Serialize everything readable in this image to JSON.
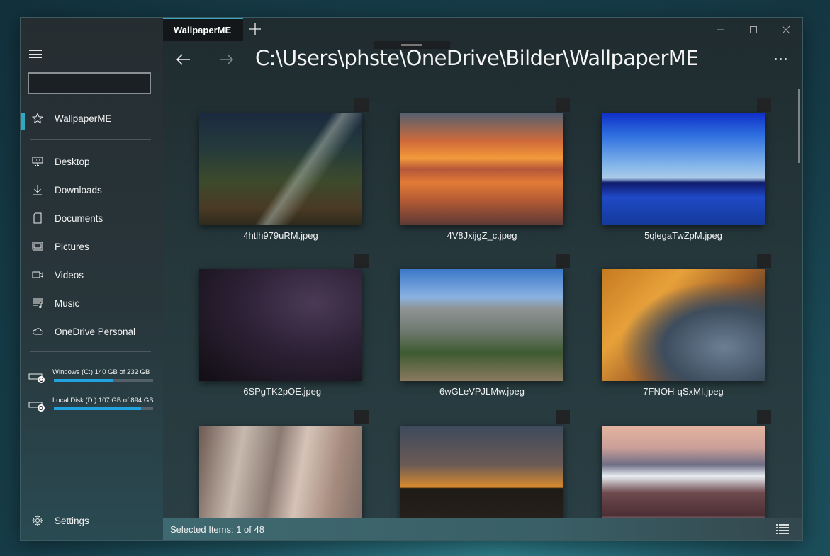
{
  "window": {
    "tab_title": "WallpaperME",
    "path": "C:\\Users\\phste\\OneDrive\\Bilder\\WallpaperME"
  },
  "sidebar": {
    "search": {
      "value": "",
      "placeholder": ""
    },
    "favorites": [
      {
        "label": "WallpaperME",
        "icon": "star-icon",
        "active": true
      }
    ],
    "items": [
      {
        "label": "Desktop",
        "icon": "desktop-icon"
      },
      {
        "label": "Downloads",
        "icon": "download-icon"
      },
      {
        "label": "Documents",
        "icon": "document-icon"
      },
      {
        "label": "Pictures",
        "icon": "pictures-icon"
      },
      {
        "label": "Videos",
        "icon": "video-icon"
      },
      {
        "label": "Music",
        "icon": "music-icon"
      },
      {
        "label": "OneDrive Personal",
        "icon": "cloud-icon"
      }
    ],
    "drives": [
      {
        "label": "Windows (C:) 140 GB of 232 GB",
        "letter": "C",
        "used_fraction": 0.603
      },
      {
        "label": "Local Disk (D:) 107 GB of 894 GB",
        "letter": "D",
        "used_fraction": 0.88
      }
    ],
    "settings_label": "Settings"
  },
  "files": [
    {
      "name": "4htlh979uRM.jpeg"
    },
    {
      "name": "4V8JxijgZ_c.jpeg"
    },
    {
      "name": "5qlegaTwZpM.jpeg"
    },
    {
      "name": "-6SPgTK2pOE.jpeg"
    },
    {
      "name": "6wGLeVPJLMw.jpeg"
    },
    {
      "name": "7FNOH-qSxMI.jpeg"
    },
    {
      "name": ""
    },
    {
      "name": ""
    },
    {
      "name": ""
    }
  ],
  "status": {
    "text": "Selected Items: 1 of 48"
  },
  "colors": {
    "accent": "#2fa8c2",
    "drive_bar": "#22a3e0"
  }
}
